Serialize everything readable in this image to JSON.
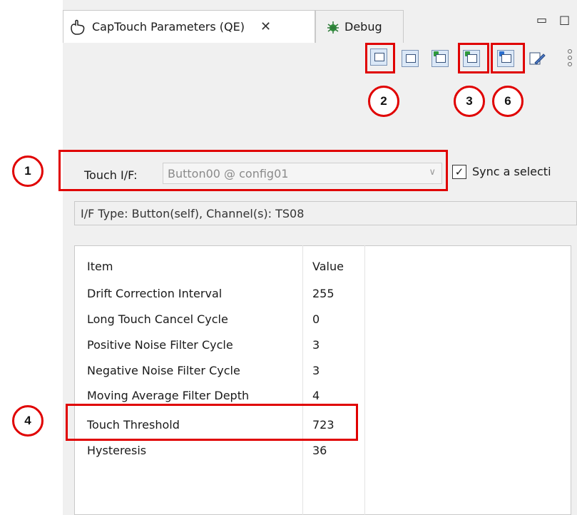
{
  "tabs": [
    {
      "label": "CapTouch Parameters (QE)",
      "icon": "hand-touch-icon",
      "close": "✕"
    },
    {
      "label": "Debug",
      "icon": "debug-bug-icon"
    }
  ],
  "window_controls": {
    "minimize": "▭",
    "maximize": "□"
  },
  "toolbar": {
    "icons": [
      "monitor-refresh-icon",
      "view-list-icon",
      "table-export-icon",
      "table-upload-green-icon",
      "table-upload-blue-icon",
      "edit-icon",
      "more-icon"
    ]
  },
  "callouts": {
    "c1": "1",
    "c2": "2",
    "c3": "3",
    "c4": "4",
    "c6": "6"
  },
  "touch_if": {
    "label": "Touch I/F:",
    "value": "Button00 @ config01",
    "sync_label": "Sync a selecti"
  },
  "if_type": "I/F Type: Button(self), Channel(s): TS08",
  "table": {
    "headers": {
      "item": "Item",
      "value": "Value"
    },
    "rows": [
      {
        "item": "Drift Correction Interval",
        "value": "255"
      },
      {
        "item": "Long Touch Cancel Cycle",
        "value": "0"
      },
      {
        "item": "Positive Noise Filter Cycle",
        "value": "3"
      },
      {
        "item": "Negative Noise Filter Cycle",
        "value": "3"
      },
      {
        "item": "Moving Average Filter Depth",
        "value": "4"
      },
      {
        "item": "Touch Threshold",
        "value": "723"
      },
      {
        "item": "Hysteresis",
        "value": "36"
      }
    ]
  },
  "colors": {
    "highlight": "#e00000",
    "panel_bg": "#f0f0f0"
  }
}
